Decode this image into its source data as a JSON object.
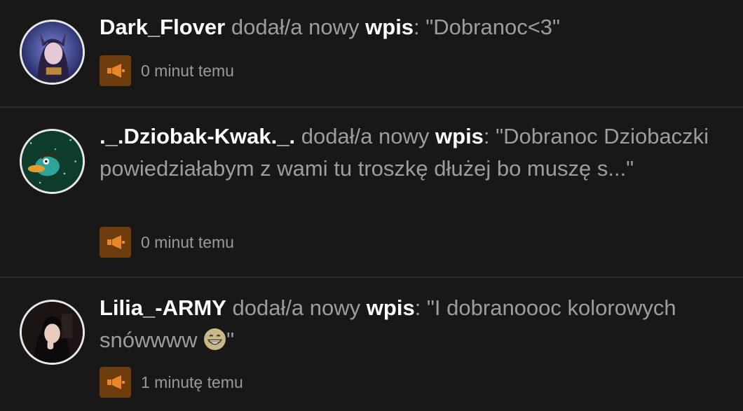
{
  "feed": {
    "items": [
      {
        "user": "Dark_Flover",
        "action": " dodał/a nowy ",
        "kind": "wpis",
        "colon": ": ",
        "quote": "\"Dobranoc<3\"",
        "quote_end": "",
        "time": "0 minut temu",
        "avatar_icon": "avatar-dark-flover",
        "badge_icon": "megaphone-icon"
      },
      {
        "user": "._.Dziobak-Kwak._.",
        "action": " dodał/a nowy ",
        "kind": "wpis",
        "colon": ": ",
        "quote": "\"Dobranoc Dziobaczki powiedziałabym z wami tu troszkę dłużej bo muszę s...\"",
        "quote_end": "",
        "time": "0 minut temu",
        "avatar_icon": "avatar-platypus",
        "badge_icon": "megaphone-icon"
      },
      {
        "user": "Lilia_-ARMY",
        "action": " dodał/a nowy ",
        "kind": "wpis",
        "colon": ": ",
        "quote": "\"I dobranoooc kolorowych snówwww ",
        "quote_end": "\"",
        "time": "1 minutę temu",
        "avatar_icon": "avatar-lilia",
        "badge_icon": "megaphone-icon",
        "emoji": "grinning-face-icon"
      }
    ]
  },
  "colors": {
    "background": "#181818",
    "divider": "#2c2c2c",
    "badge": "#6e3d0e",
    "badge_icon": "#e8862a",
    "username": "#ffffff",
    "body_text": "#9d9d9d"
  }
}
